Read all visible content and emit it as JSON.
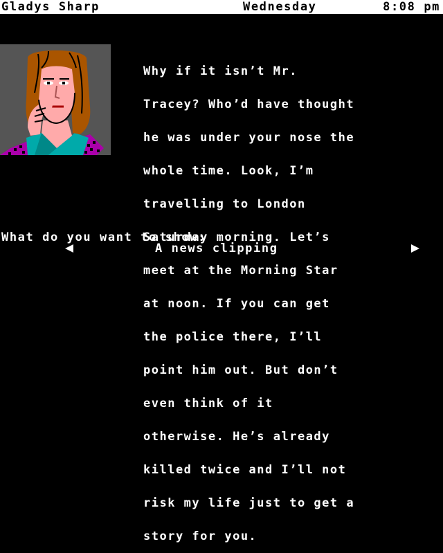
{
  "status_bar": {
    "character_name": "Gladys Sharp",
    "day": "Wednesday",
    "time": "8:08 pm"
  },
  "dialogue": {
    "lines": [
      "Why if it isn’t Mr.",
      "Tracey? Who’d have thought",
      "he was under your nose the",
      "whole time. Look, I’m",
      "travelling to London",
      "Saturday morning. Let’s",
      "meet at the Morning Star",
      "at noon. If you can get",
      "the police there, I’ll",
      "point him out. But don’t",
      "even think of it",
      "otherwise. He’s already",
      "killed twice and I’ll not",
      "risk my life just to get a",
      "story for you."
    ]
  },
  "prompt": {
    "question": "What do you want to show:",
    "selected_item": "A news clipping",
    "prev_icon": "left-arrow-icon",
    "next_icon": "right-arrow-icon"
  },
  "portrait": {
    "subject": "Gladys Sharp portrait",
    "colors": {
      "background": "#555555",
      "hair": "#aa5500",
      "skin": "#ffaaaa",
      "outline": "#000000",
      "collar": "#00aaaa",
      "dress": "#aa00aa"
    }
  },
  "colors": {
    "screen_bg": "#000000",
    "text": "#ffffff",
    "status_bg": "#ffffff",
    "status_text": "#000000"
  }
}
